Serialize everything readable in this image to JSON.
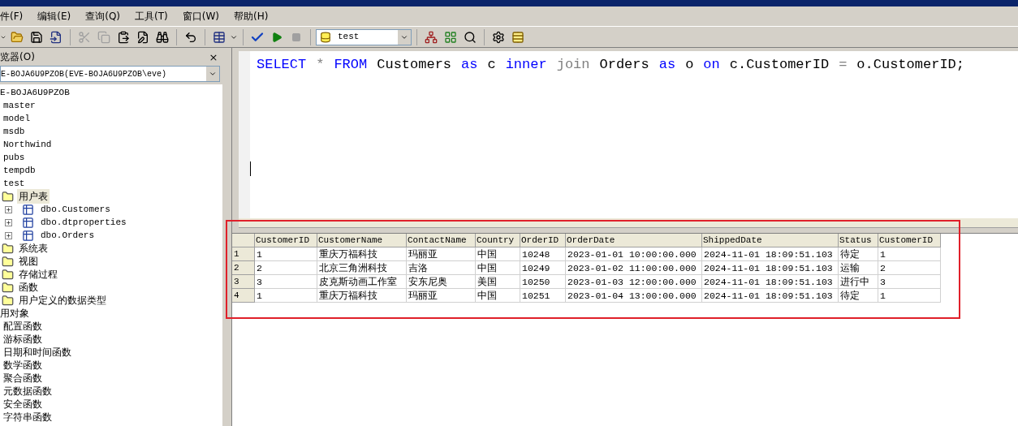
{
  "menu": [
    "件(F)",
    "编辑(E)",
    "查询(Q)",
    "工具(T)",
    "窗口(W)",
    "帮助(H)"
  ],
  "toolbar": {
    "database": "test"
  },
  "object_browser": {
    "title": "览器(O)",
    "close": "×",
    "server": "E-BOJA6U9PZOB(EVE-BOJA6U9PZOB\\eve)",
    "tree": [
      {
        "label": "E-BOJA6U9PZOB",
        "kind": "server",
        "children": [
          {
            "label": "master",
            "kind": "db"
          },
          {
            "label": "model",
            "kind": "db"
          },
          {
            "label": "msdb",
            "kind": "db"
          },
          {
            "label": "Northwind",
            "kind": "db"
          },
          {
            "label": "pubs",
            "kind": "db"
          },
          {
            "label": "tempdb",
            "kind": "db"
          },
          {
            "label": "test",
            "kind": "db",
            "children": [
              {
                "label": "用户表",
                "kind": "folder",
                "selected": true,
                "children": [
                  {
                    "label": "dbo.Customers",
                    "kind": "table"
                  },
                  {
                    "label": "dbo.dtproperties",
                    "kind": "table"
                  },
                  {
                    "label": "dbo.Orders",
                    "kind": "table"
                  }
                ]
              },
              {
                "label": "系统表",
                "kind": "folder",
                "selected": false
              },
              {
                "label": "视图",
                "kind": "folder",
                "selected": false
              },
              {
                "label": "存储过程",
                "kind": "folder",
                "selected": false
              },
              {
                "label": "函数",
                "kind": "folder",
                "selected": false
              },
              {
                "label": "用户定义的数据类型",
                "kind": "folder",
                "selected": false
              }
            ]
          }
        ]
      },
      {
        "label": "用对象",
        "kind": "group",
        "children": [
          {
            "label": "配置函数",
            "kind": "item"
          },
          {
            "label": "游标函数",
            "kind": "item"
          },
          {
            "label": "日期和时间函数",
            "kind": "item"
          },
          {
            "label": "数学函数",
            "kind": "item"
          },
          {
            "label": "聚合函数",
            "kind": "item"
          },
          {
            "label": "元数据函数",
            "kind": "item"
          },
          {
            "label": "安全函数",
            "kind": "item"
          },
          {
            "label": "字符串函数",
            "kind": "item"
          }
        ]
      }
    ]
  },
  "editor": {
    "tokens": [
      {
        "text": "SELECT",
        "kind": "keyword"
      },
      {
        "text": "*",
        "kind": "operator"
      },
      {
        "text": "FROM",
        "kind": "keyword"
      },
      {
        "text": "Customers",
        "kind": "ident"
      },
      {
        "text": "as",
        "kind": "keyword"
      },
      {
        "text": "c",
        "kind": "ident"
      },
      {
        "text": "inner",
        "kind": "keyword"
      },
      {
        "text": "join",
        "kind": "operator"
      },
      {
        "text": "Orders",
        "kind": "ident"
      },
      {
        "text": "as",
        "kind": "keyword"
      },
      {
        "text": "o",
        "kind": "ident"
      },
      {
        "text": "on",
        "kind": "keyword"
      },
      {
        "text": "c.CustomerID",
        "kind": "ident"
      },
      {
        "text": "=",
        "kind": "operator"
      },
      {
        "text": "o.CustomerID;",
        "kind": "ident"
      }
    ]
  },
  "results": {
    "columns": [
      "CustomerID",
      "CustomerName",
      "ContactName",
      "Country",
      "OrderID",
      "OrderDate",
      "ShippedDate",
      "Status",
      "CustomerID"
    ],
    "rows": [
      {
        "number": "1",
        "cells": [
          "1",
          "重庆万福科技",
          "玛丽亚",
          "中国",
          "10248",
          "2023-01-01 10:00:00.000",
          "2024-11-01 18:09:51.103",
          "待定",
          "1"
        ]
      },
      {
        "number": "2",
        "cells": [
          "2",
          "北京三角洲科技",
          "吉洛",
          "中国",
          "10249",
          "2023-01-02 11:00:00.000",
          "2024-11-01 18:09:51.103",
          "运输",
          "2"
        ]
      },
      {
        "number": "3",
        "cells": [
          "3",
          "皮克斯动画工作室",
          "安东尼奥",
          "美国",
          "10250",
          "2023-01-03 12:00:00.000",
          "2024-11-01 18:09:51.103",
          "进行中",
          "3"
        ]
      },
      {
        "number": "4",
        "cells": [
          "1",
          "重庆万福科技",
          "玛丽亚",
          "中国",
          "10251",
          "2023-01-04 13:00:00.000",
          "2024-11-01 18:09:51.103",
          "待定",
          "1"
        ]
      }
    ]
  }
}
